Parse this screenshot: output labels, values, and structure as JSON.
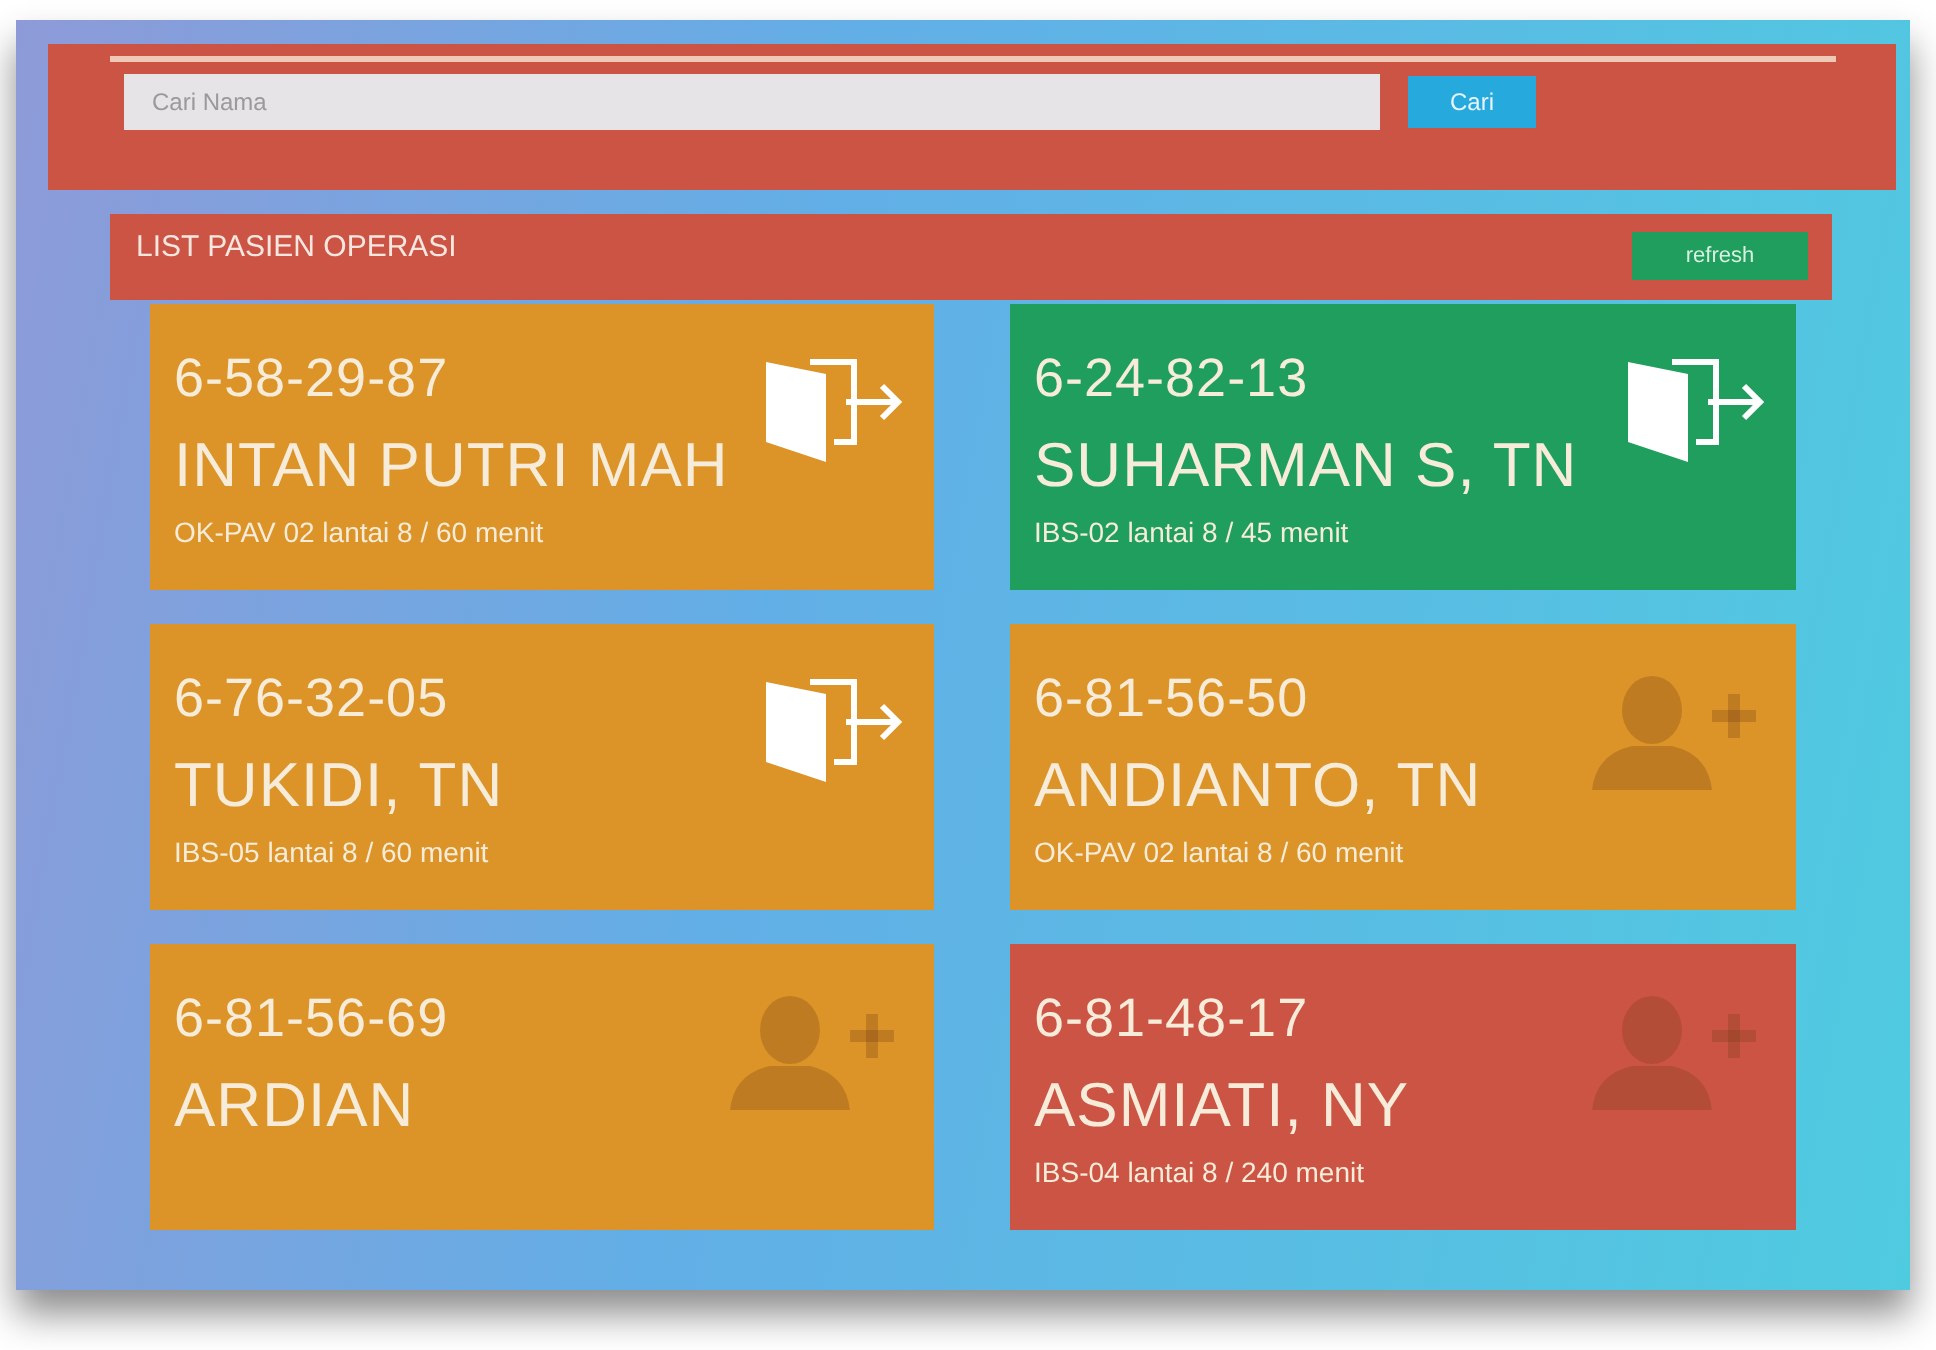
{
  "search": {
    "placeholder": "Cari Nama",
    "button": "Cari"
  },
  "list": {
    "title": "LIST PASIEN OPERASI",
    "refresh": "refresh"
  },
  "patients": [
    {
      "id": "6-58-29-87",
      "name": "INTAN PUTRI MAH",
      "info": "OK-PAV 02 lantai 8 / 60 menit",
      "color": "#dc9428",
      "kind": "exit"
    },
    {
      "id": "6-24-82-13",
      "name": "SUHARMAN S, TN",
      "info": "IBS-02 lantai 8 / 45 menit",
      "color": "#1f9e5d",
      "kind": "exit"
    },
    {
      "id": "6-76-32-05",
      "name": "TUKIDI, TN",
      "info": "IBS-05 lantai 8 / 60 menit",
      "color": "#dc9428",
      "kind": "exit"
    },
    {
      "id": "6-81-56-50",
      "name": "ANDIANTO, TN",
      "info": "OK-PAV 02 lantai 8 / 60 menit",
      "color": "#dc9428",
      "kind": "add"
    },
    {
      "id": "6-81-56-69",
      "name": "ARDIAN",
      "color": "#dc9428",
      "kind": "add"
    },
    {
      "id": "6-81-48-17",
      "name": "ASMIATI, NY",
      "info": "IBS-04 lantai 8 / 240 menit",
      "color": "#cc5444",
      "kind": "add"
    }
  ]
}
